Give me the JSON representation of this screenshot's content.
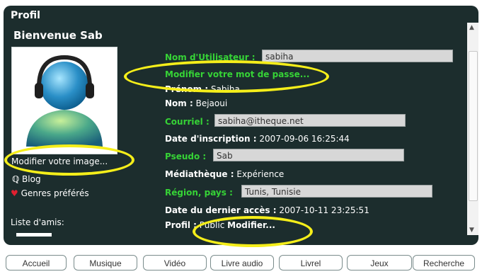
{
  "panel": {
    "title": "Profil",
    "welcome": "Bienvenue Sab"
  },
  "left": {
    "change_image": "Modifier votre image...",
    "blog": "Blog",
    "genres": "Genres préférés",
    "friends_label": "Liste d'amis:"
  },
  "profile": {
    "username_label": "Nom d'Utilisateur :",
    "username_value": "sabiha",
    "change_password": "Modifier votre mot de passe...",
    "firstname_label": "Prénom :",
    "firstname_value": "Sabiha",
    "lastname_label": "Nom :",
    "lastname_value": "Bejaoui",
    "email_label": "Courriel :",
    "email_value": "sabiha@itheque.net",
    "signup_label": "Date d'inscription :",
    "signup_value": "2007-09-06 16:25:44",
    "pseudo_label": "Pseudo :",
    "pseudo_value": "Sab",
    "library_label": "Médiathèque :",
    "library_value": "Expérience",
    "region_label": "Région, pays :",
    "region_value": "Tunis, Tunisie",
    "last_access_label": "Date du dernier accès :",
    "last_access_value": "2007-10-11 23:25:51",
    "profile_label": "Profil :",
    "profile_value": "Public",
    "profile_modify": "Modifier..."
  },
  "tabs": [
    "Accueil",
    "Musique",
    "Vidéo",
    "Livre audio",
    "Livrel",
    "Jeux",
    "Recherche"
  ],
  "colors": {
    "panel_bg": "#1c2d2d",
    "green_label": "#36d336",
    "highlight_ring": "#f5ee1a"
  }
}
